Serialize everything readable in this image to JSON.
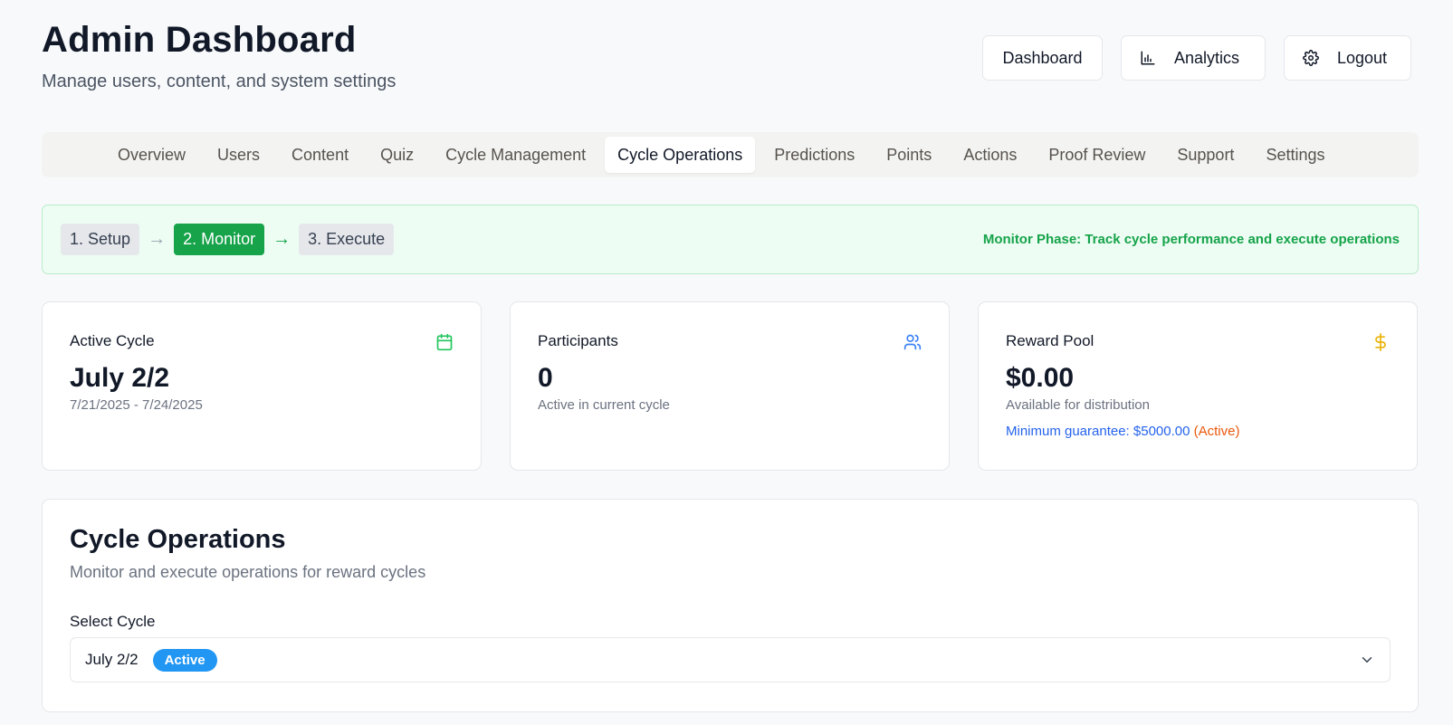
{
  "header": {
    "title": "Admin Dashboard",
    "subtitle": "Manage users, content, and system settings",
    "buttons": {
      "dashboard": "Dashboard",
      "analytics": "Analytics",
      "analytics_icon": "bar-chart-icon",
      "logout": "Logout",
      "logout_icon": "gear-icon"
    }
  },
  "tabs": [
    {
      "label": "Overview"
    },
    {
      "label": "Users"
    },
    {
      "label": "Content"
    },
    {
      "label": "Quiz"
    },
    {
      "label": "Cycle Management"
    },
    {
      "label": "Cycle Operations",
      "active": true
    },
    {
      "label": "Predictions"
    },
    {
      "label": "Points"
    },
    {
      "label": "Actions"
    },
    {
      "label": "Proof Review"
    },
    {
      "label": "Support"
    },
    {
      "label": "Settings"
    }
  ],
  "phase": {
    "steps": [
      {
        "label": "1. Setup"
      },
      {
        "label": "2. Monitor",
        "current": true
      },
      {
        "label": "3. Execute"
      }
    ],
    "arrow": "→",
    "message": "Monitor Phase: Track cycle performance and execute operations",
    "accent_color": "#16a34a"
  },
  "cards": {
    "active_cycle": {
      "label": "Active Cycle",
      "icon": "calendar-icon",
      "icon_color": "#22c55e",
      "value": "July 2/2",
      "sub": "7/21/2025 - 7/24/2025"
    },
    "participants": {
      "label": "Participants",
      "icon": "users-icon",
      "icon_color": "#3b82f6",
      "value": "0",
      "sub": "Active in current cycle"
    },
    "reward_pool": {
      "label": "Reward Pool",
      "icon": "dollar-icon",
      "icon_color": "#eab308",
      "value": "$0.00",
      "sub": "Available for distribution",
      "guarantee": "Minimum guarantee: $5000.00",
      "guarantee_status": "(Active)"
    }
  },
  "operations": {
    "title": "Cycle Operations",
    "description": "Monitor and execute operations for reward cycles",
    "select_label": "Select Cycle",
    "selected_value": "July 2/2",
    "selected_badge": "Active",
    "badge_color": "#2196f3"
  }
}
